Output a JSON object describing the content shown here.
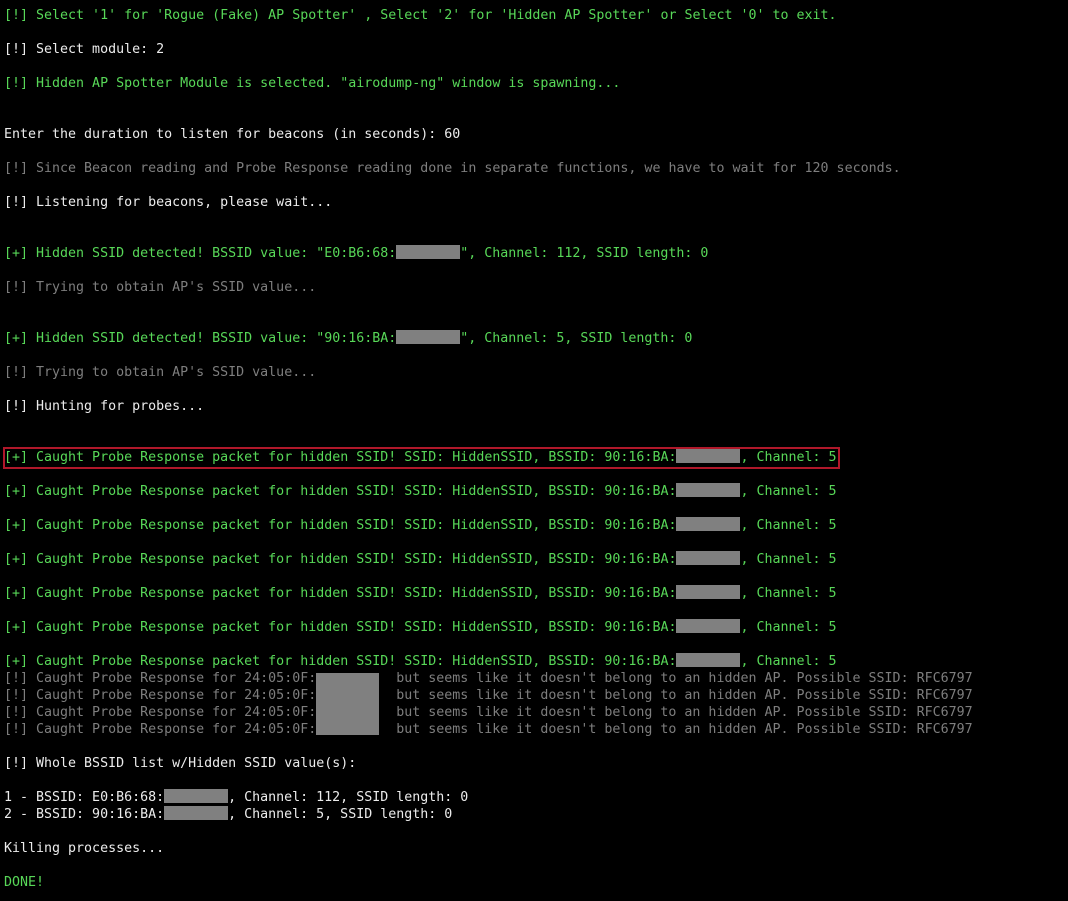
{
  "terminal": {
    "select_prompt": "[!] Select '1' for 'Rogue (Fake) AP Spotter' , Select '2' for 'Hidden AP Spotter' or Select '0' to exit.",
    "select_module": "[!] Select module: 2",
    "module_selected": "[!] Hidden AP Spotter Module is selected. \"airodump-ng\" window is spawning...",
    "duration_prompt": "Enter the duration to listen for beacons (in seconds): 60",
    "wait_notice": "[!] Since Beacon reading and Probe Response reading done in separate functions, we have to wait for 120 seconds.",
    "listening": "[!] Listening for beacons, please wait...",
    "detections": [
      {
        "prefix": "[+] Hidden SSID detected! BSSID value: \"E0:B6:68:",
        "suffix": "\", Channel: 112, SSID length: 0",
        "trying": "[!] Trying to obtain AP's SSID value..."
      },
      {
        "prefix": "[+] Hidden SSID detected! BSSID value: \"90:16:BA:",
        "suffix": "\", Channel: 5, SSID length: 0",
        "trying": "[!] Trying to obtain AP's SSID value..."
      }
    ],
    "hunting": "[!] Hunting for probes...",
    "probe_caught": [
      {
        "prefix": "[+] Caught Probe Response packet for hidden SSID! SSID: HiddenSSID, BSSID: 90:16:BA:",
        "suffix": ", Channel: 5"
      },
      {
        "prefix": "[+] Caught Probe Response packet for hidden SSID! SSID: HiddenSSID, BSSID: 90:16:BA:",
        "suffix": ", Channel: 5"
      },
      {
        "prefix": "[+] Caught Probe Response packet for hidden SSID! SSID: HiddenSSID, BSSID: 90:16:BA:",
        "suffix": ", Channel: 5"
      },
      {
        "prefix": "[+] Caught Probe Response packet for hidden SSID! SSID: HiddenSSID, BSSID: 90:16:BA:",
        "suffix": ", Channel: 5"
      },
      {
        "prefix": "[+] Caught Probe Response packet for hidden SSID! SSID: HiddenSSID, BSSID: 90:16:BA:",
        "suffix": ", Channel: 5"
      },
      {
        "prefix": "[+] Caught Probe Response packet for hidden SSID! SSID: HiddenSSID, BSSID: 90:16:BA:",
        "suffix": ", Channel: 5"
      },
      {
        "prefix": "[+] Caught Probe Response packet for hidden SSID! SSID: HiddenSSID, BSSID: 90:16:BA:",
        "suffix": ", Channel: 5"
      }
    ],
    "probe_not_hidden": [
      {
        "prefix": "[!] Caught Probe Response for 24:05:0F:",
        "suffix": " but seems like it doesn't belong to an hidden AP. Possible SSID: RFC6797"
      },
      {
        "prefix": "[!] Caught Probe Response for 24:05:0F:",
        "suffix": " but seems like it doesn't belong to an hidden AP. Possible SSID: RFC6797"
      },
      {
        "prefix": "[!] Caught Probe Response for 24:05:0F:",
        "suffix": " but seems like it doesn't belong to an hidden AP. Possible SSID: RFC6797"
      },
      {
        "prefix": "[!] Caught Probe Response for 24:05:0F:",
        "suffix": " but seems like it doesn't belong to an hidden AP. Possible SSID: RFC6797"
      }
    ],
    "whole_list_header": "[!] Whole BSSID list w/Hidden SSID value(s):",
    "bssid_list": [
      {
        "prefix": "1 - BSSID: E0:B6:68:",
        "suffix": ", Channel: 112, SSID length: 0"
      },
      {
        "prefix": "2 - BSSID: 90:16:BA:",
        "suffix": ", Channel: 5, SSID length: 0"
      }
    ],
    "killing": "Killing processes...",
    "done": "DONE!"
  },
  "colors": {
    "background": "#000000",
    "green": "#58d858",
    "white": "#ececec",
    "gray": "#7e7e7e",
    "redaction": "#808080",
    "highlight_border": "#b0182a"
  }
}
